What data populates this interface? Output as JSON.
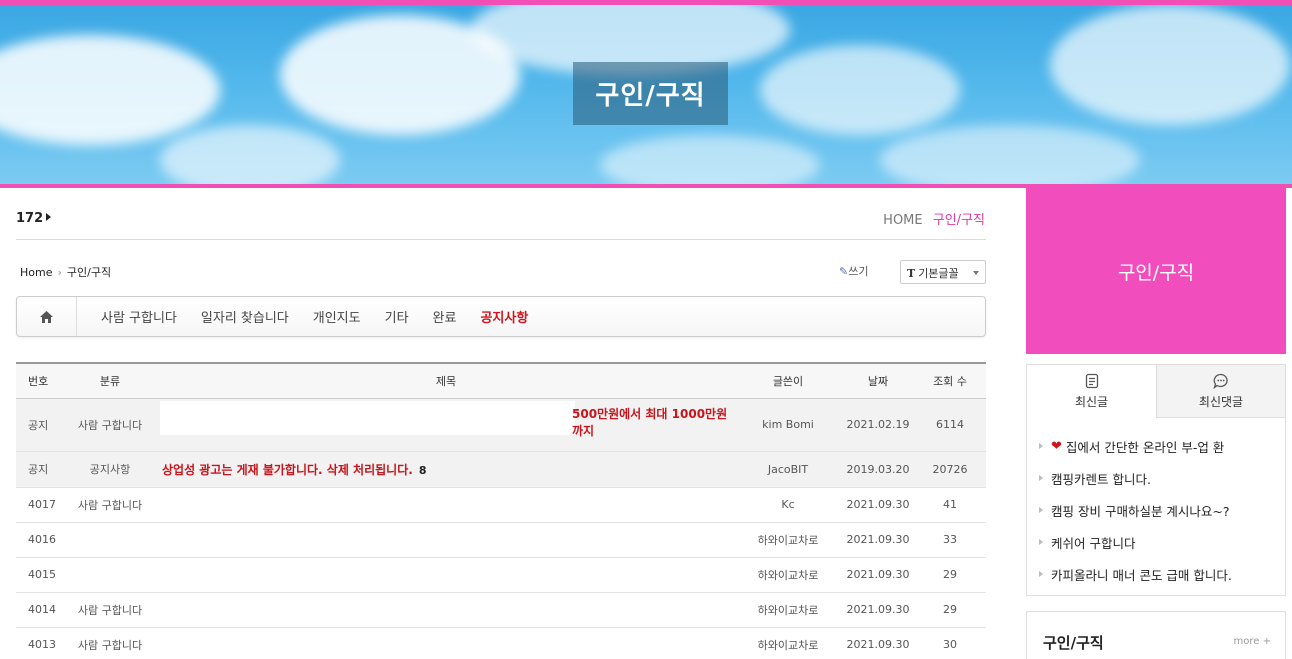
{
  "banner": {
    "title": "구인/구직"
  },
  "page": {
    "count": "172",
    "breadcrumb_home": "HOME",
    "breadcrumb_current": "구인/구직",
    "sub_breadcrumb_home": "Home",
    "sub_breadcrumb_current": "구인/구직",
    "write_label": "쓰기",
    "font_select_label": "기본글꼴"
  },
  "category_nav": {
    "items": [
      "사람 구합니다",
      "일자리 찾습니다",
      "개인지도",
      "기타",
      "완료",
      "공지사항"
    ]
  },
  "board": {
    "headers": {
      "num": "번호",
      "category": "분류",
      "subject": "제목",
      "writer": "글쓴이",
      "date": "날짜",
      "views": "조회 수"
    },
    "rows": [
      {
        "num": "공지",
        "category": "사람 구합니다",
        "subject": "500만원에서 최대 1000만원까지",
        "writer": "kim Bomi",
        "date": "2021.02.19",
        "views": "6114"
      },
      {
        "num": "공지",
        "category": "공지사항",
        "subject": "상업성 광고는 게재 불가합니다. 삭제 처리됩니다.",
        "comments": "8",
        "writer": "JacoBIT",
        "date": "2019.03.20",
        "views": "20726"
      },
      {
        "num": "4017",
        "category": "사람 구합니다",
        "subject": "",
        "writer": "Kc",
        "date": "2021.09.30",
        "views": "41"
      },
      {
        "num": "4016",
        "category": "",
        "subject": "",
        "writer": "하와이교차로",
        "date": "2021.09.30",
        "views": "33"
      },
      {
        "num": "4015",
        "category": "",
        "subject": "",
        "writer": "하와이교차로",
        "date": "2021.09.30",
        "views": "29"
      },
      {
        "num": "4014",
        "category": "사람 구합니다",
        "subject": "",
        "writer": "하와이교차로",
        "date": "2021.09.30",
        "views": "29"
      },
      {
        "num": "4013",
        "category": "사람 구합니다",
        "subject": "",
        "writer": "하와이교차로",
        "date": "2021.09.30",
        "views": "30"
      }
    ]
  },
  "sidebar": {
    "title": "구인/구직",
    "tabs": {
      "recent_posts": "최신글",
      "recent_comments": "최신댓글"
    },
    "recent_posts": [
      "집에서 간단한 온라인 부-업 환",
      "캠핑카렌트 합니다.",
      "캠핑 장비 구매하실분 계시나요~?",
      "케쉬어 구합니다",
      "카피올라니 매너 콘도 급매 합니다."
    ],
    "box2_title": "구인/구직",
    "box2_more": "more +"
  }
}
